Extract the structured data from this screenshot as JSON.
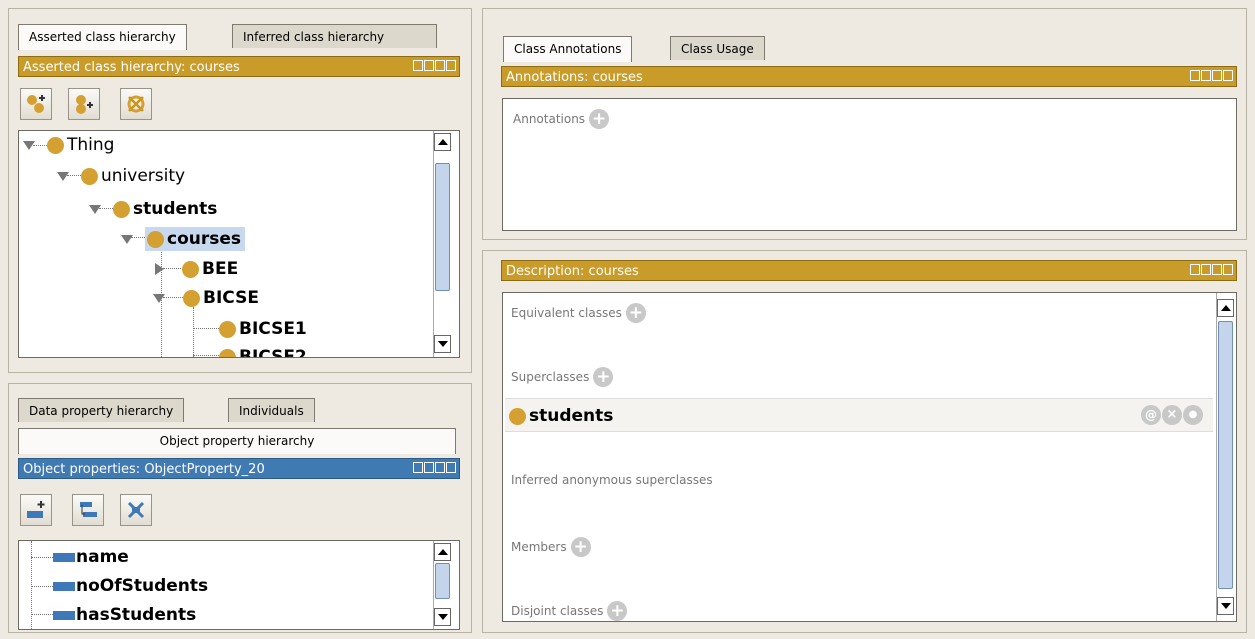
{
  "class_panel": {
    "tabs": [
      "Asserted class hierarchy",
      "Inferred class hierarchy"
    ],
    "title": "Asserted class hierarchy: courses",
    "toolbar": [
      "add-subclass-icon",
      "add-sibling-class-icon",
      "delete-class-icon"
    ],
    "tree": [
      {
        "label": "Thing"
      },
      {
        "label": "university"
      },
      {
        "label": "students"
      },
      {
        "label": "courses"
      },
      {
        "label": "BEE"
      },
      {
        "label": "BICSE"
      },
      {
        "label": "BICSE1"
      },
      {
        "label": "BICSE2"
      }
    ]
  },
  "property_panel": {
    "tabs": [
      "Data property hierarchy",
      "Individuals"
    ],
    "active_tab": "Object property hierarchy",
    "title": "Object properties: ObjectProperty_20",
    "toolbar": [
      "add-sub-property-icon",
      "add-sibling-property-icon",
      "delete-property-icon"
    ],
    "items": [
      "name",
      "noOfStudents",
      "hasStudents"
    ]
  },
  "annotations_panel": {
    "tabs": [
      "Class Annotations",
      "Class Usage"
    ],
    "title": "Annotations: courses",
    "label": "Annotations"
  },
  "description_panel": {
    "title": "Description: courses",
    "equivalent_label": "Equivalent classes",
    "superclasses_label": "Superclasses",
    "superclass_item": "students",
    "inferred_label": "Inferred anonymous superclasses",
    "members_label": "Members",
    "disjoint_label": "Disjoint classes"
  },
  "colors": {
    "gold": "#c99c2a",
    "blue": "#3f7ab3"
  }
}
